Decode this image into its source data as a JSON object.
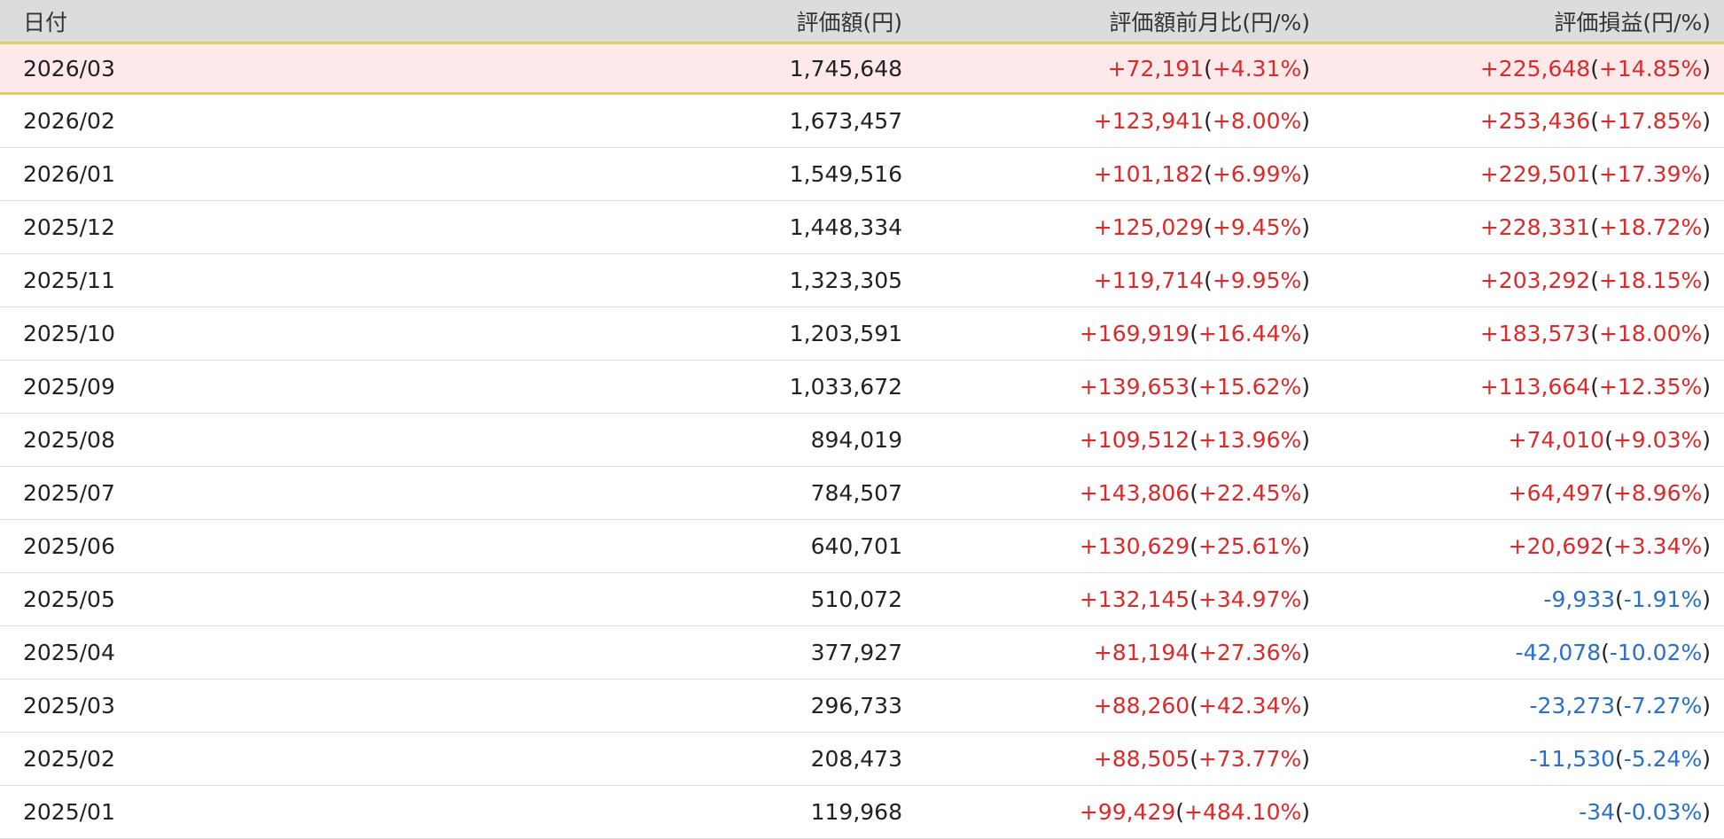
{
  "colors": {
    "header_bg": "#dcdcdc",
    "current_row_bg": "#fde9ea",
    "current_row_border": "#e2cd6a",
    "positive": "#d92b2b",
    "negative": "#2a6fc9"
  },
  "table": {
    "headers": {
      "date": "日付",
      "value": "評価額(円)",
      "change": "評価額前月比(円/%)",
      "pl": "評価損益(円/%)"
    },
    "rows": [
      {
        "date": "2026/03",
        "value": "1,745,648",
        "change_amt": "+72,191",
        "change_pct": "+4.31%",
        "change_sign": "pos",
        "pl_amt": "+225,648",
        "pl_pct": "+14.85%",
        "pl_sign": "pos",
        "current": true
      },
      {
        "date": "2026/02",
        "value": "1,673,457",
        "change_amt": "+123,941",
        "change_pct": "+8.00%",
        "change_sign": "pos",
        "pl_amt": "+253,436",
        "pl_pct": "+17.85%",
        "pl_sign": "pos"
      },
      {
        "date": "2026/01",
        "value": "1,549,516",
        "change_amt": "+101,182",
        "change_pct": "+6.99%",
        "change_sign": "pos",
        "pl_amt": "+229,501",
        "pl_pct": "+17.39%",
        "pl_sign": "pos"
      },
      {
        "date": "2025/12",
        "value": "1,448,334",
        "change_amt": "+125,029",
        "change_pct": "+9.45%",
        "change_sign": "pos",
        "pl_amt": "+228,331",
        "pl_pct": "+18.72%",
        "pl_sign": "pos"
      },
      {
        "date": "2025/11",
        "value": "1,323,305",
        "change_amt": "+119,714",
        "change_pct": "+9.95%",
        "change_sign": "pos",
        "pl_amt": "+203,292",
        "pl_pct": "+18.15%",
        "pl_sign": "pos"
      },
      {
        "date": "2025/10",
        "value": "1,203,591",
        "change_amt": "+169,919",
        "change_pct": "+16.44%",
        "change_sign": "pos",
        "pl_amt": "+183,573",
        "pl_pct": "+18.00%",
        "pl_sign": "pos"
      },
      {
        "date": "2025/09",
        "value": "1,033,672",
        "change_amt": "+139,653",
        "change_pct": "+15.62%",
        "change_sign": "pos",
        "pl_amt": "+113,664",
        "pl_pct": "+12.35%",
        "pl_sign": "pos"
      },
      {
        "date": "2025/08",
        "value": "894,019",
        "change_amt": "+109,512",
        "change_pct": "+13.96%",
        "change_sign": "pos",
        "pl_amt": "+74,010",
        "pl_pct": "+9.03%",
        "pl_sign": "pos"
      },
      {
        "date": "2025/07",
        "value": "784,507",
        "change_amt": "+143,806",
        "change_pct": "+22.45%",
        "change_sign": "pos",
        "pl_amt": "+64,497",
        "pl_pct": "+8.96%",
        "pl_sign": "pos"
      },
      {
        "date": "2025/06",
        "value": "640,701",
        "change_amt": "+130,629",
        "change_pct": "+25.61%",
        "change_sign": "pos",
        "pl_amt": "+20,692",
        "pl_pct": "+3.34%",
        "pl_sign": "pos"
      },
      {
        "date": "2025/05",
        "value": "510,072",
        "change_amt": "+132,145",
        "change_pct": "+34.97%",
        "change_sign": "pos",
        "pl_amt": "-9,933",
        "pl_pct": "-1.91%",
        "pl_sign": "neg"
      },
      {
        "date": "2025/04",
        "value": "377,927",
        "change_amt": "+81,194",
        "change_pct": "+27.36%",
        "change_sign": "pos",
        "pl_amt": "-42,078",
        "pl_pct": "-10.02%",
        "pl_sign": "neg"
      },
      {
        "date": "2025/03",
        "value": "296,733",
        "change_amt": "+88,260",
        "change_pct": "+42.34%",
        "change_sign": "pos",
        "pl_amt": "-23,273",
        "pl_pct": "-7.27%",
        "pl_sign": "neg"
      },
      {
        "date": "2025/02",
        "value": "208,473",
        "change_amt": "+88,505",
        "change_pct": "+73.77%",
        "change_sign": "pos",
        "pl_amt": "-11,530",
        "pl_pct": "-5.24%",
        "pl_sign": "neg"
      },
      {
        "date": "2025/01",
        "value": "119,968",
        "change_amt": "+99,429",
        "change_pct": "+484.10%",
        "change_sign": "pos",
        "pl_amt": "-34",
        "pl_pct": "-0.03%",
        "pl_sign": "neg"
      }
    ]
  }
}
